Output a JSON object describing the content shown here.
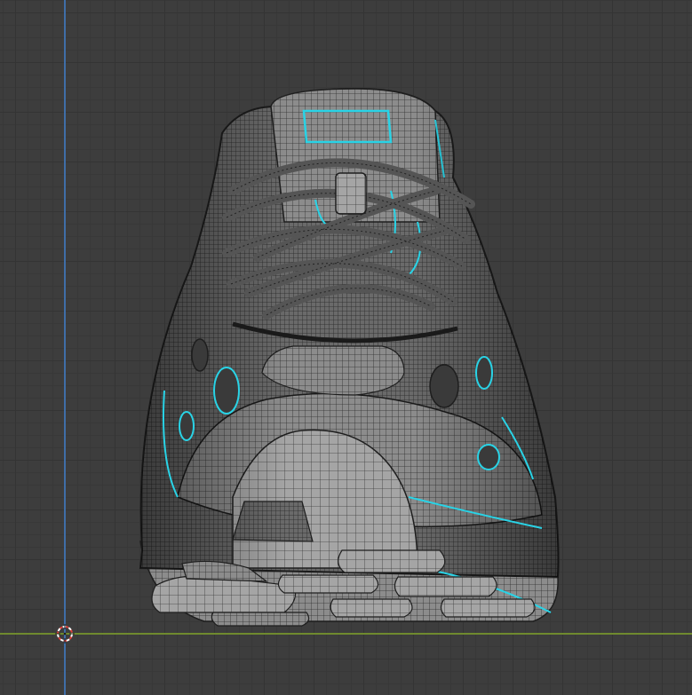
{
  "viewport": {
    "background": "#3d3d3d",
    "grid_color": "#343434",
    "axis_x_color": "#6f8a2e",
    "axis_y_color": "#3f6ea8",
    "highlight_color": "#29d3e6",
    "object_color": "#8a8a8a"
  },
  "scene": {
    "object": "shoe-mesh",
    "shading": "solid-wireframe",
    "view": "front-orthographic"
  },
  "icons": {
    "cursor": "3d-cursor-icon"
  }
}
